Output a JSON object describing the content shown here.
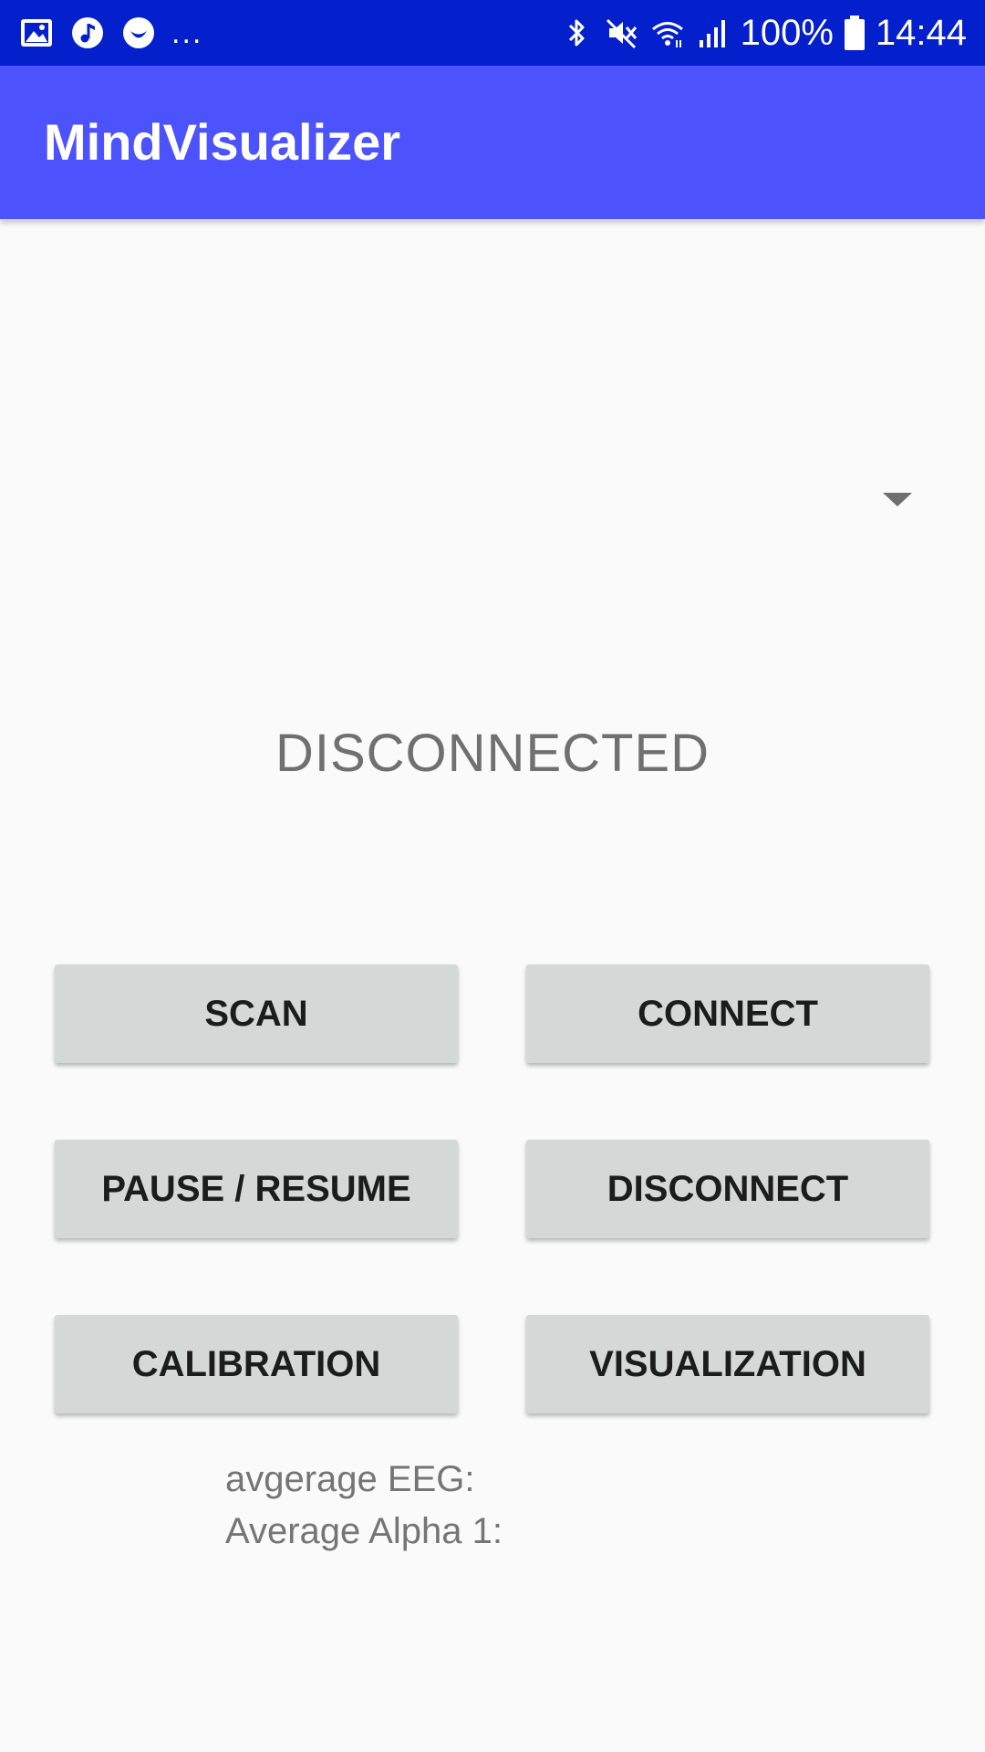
{
  "status_bar": {
    "left_icons": [
      "image-icon",
      "music-icon",
      "smiley-icon"
    ],
    "overflow": "...",
    "right_icons": [
      "bluetooth-icon",
      "mute-icon",
      "wifi-icon",
      "signal-icon"
    ],
    "battery_percent": "100%",
    "time": "14:44",
    "background_color": "#0320cc"
  },
  "app_bar": {
    "title": "MindVisualizer",
    "background_color": "#4c52fc"
  },
  "spinner": {
    "selected_value": ""
  },
  "connection_status": "DISCONNECTED",
  "buttons": {
    "scan": "SCAN",
    "connect": "CONNECT",
    "pause_resume": "PAUSE / RESUME",
    "disconnect": "DISCONNECT",
    "calibration": "CALIBRATION",
    "visualization": "VISUALIZATION"
  },
  "info": {
    "average_eeg": "avgerage EEG:",
    "average_alpha": "Average Alpha 1:"
  }
}
